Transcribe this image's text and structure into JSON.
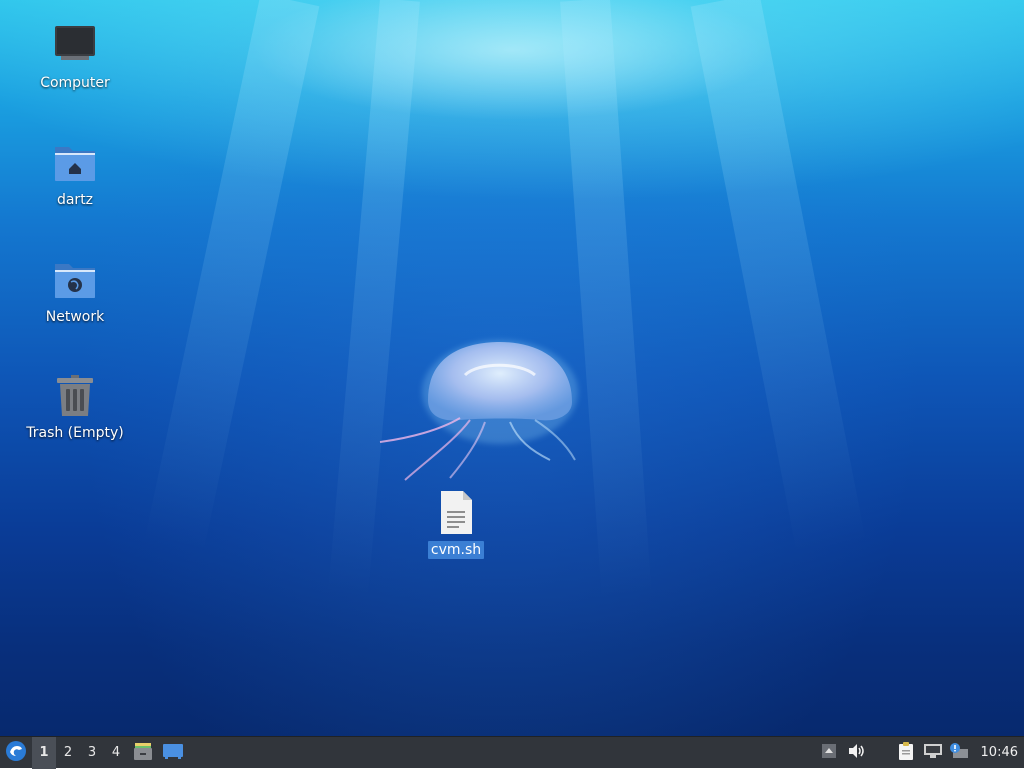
{
  "desktop": {
    "icons": [
      {
        "label": "Computer"
      },
      {
        "label": "dartz"
      },
      {
        "label": "Network"
      },
      {
        "label": "Trash (Empty)"
      },
      {
        "label": "cvm.sh"
      }
    ]
  },
  "taskbar": {
    "start_icon": "xfce-mouse-icon",
    "workspaces": [
      "1",
      "2",
      "3",
      "4"
    ],
    "active_workspace": "1",
    "launchers": [
      "file-manager-icon",
      "show-desktop-icon"
    ],
    "tray_icons": [
      "tray-expand-icon",
      "volume-icon",
      "clipboard-icon",
      "network-icon",
      "notification-icon"
    ],
    "clock": "10:46"
  },
  "colors": {
    "taskbar_bg": "#31353b",
    "selection": "#3b7fd4",
    "folder_blue": "#4a90d9"
  }
}
